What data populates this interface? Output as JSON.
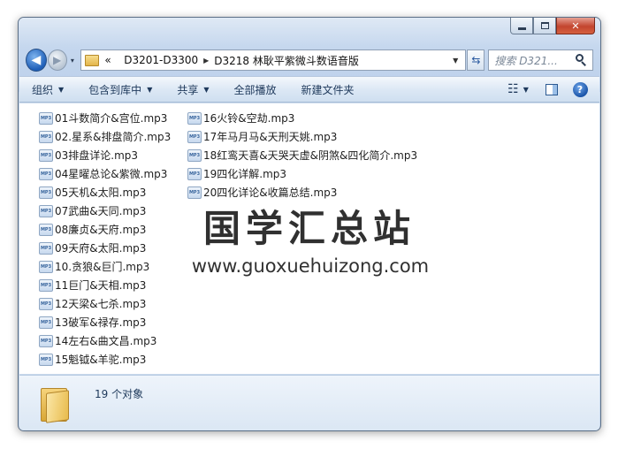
{
  "window": {
    "nav": {
      "back_glyph": "◀",
      "forward_glyph": "▶",
      "recent_glyph": "▾"
    },
    "address": {
      "overflow": "«",
      "crumbs": [
        "D3201-D3300",
        "D3218 林耿平紫微斗数语音版"
      ]
    },
    "search": {
      "placeholder": "搜索 D321..."
    },
    "toolbar": {
      "organize": "组织",
      "include_in_library": "包含到库中",
      "share": "共享",
      "play_all": "全部播放",
      "new_folder": "新建文件夹"
    },
    "icons": {
      "back": "back-arrow-icon",
      "forward": "forward-arrow-icon",
      "refresh": "refresh-icon",
      "search": "search-icon",
      "views": "view-options-icon",
      "preview_pane": "preview-pane-icon",
      "help": "help-icon",
      "file": "mp3-file-icon",
      "folder": "folder-icon"
    },
    "file_icon_label": "MP3",
    "files_col1": [
      "01斗数简介&宫位.mp3",
      "02.星系&排盘简介.mp3",
      "03排盘详论.mp3",
      "04星曜总论&紫微.mp3",
      "05天机&太阳.mp3",
      "07武曲&天同.mp3",
      "08廉贞&天府.mp3",
      "09天府&太阳.mp3",
      "10.贪狼&巨门.mp3",
      "11巨门&天相.mp3",
      "12天梁&七杀.mp3",
      "13破军&禄存.mp3",
      "14左右&曲文昌.mp3",
      "15魁钺&羊驼.mp3"
    ],
    "files_col2": [
      "16火铃&空劫.mp3",
      "17年马月马&天刑天姚.mp3",
      "18红鸾天喜&天哭天虚&阴煞&四化简介.mp3",
      "19四化详解.mp3",
      "20四化详论&收篇总结.mp3"
    ],
    "watermark": {
      "title": "国学汇总站",
      "url": "www.guoxuehuizong.com"
    },
    "status": {
      "count": "19 个对象"
    },
    "colors": {
      "frame": "#c9d9ec",
      "toolbar_text": "#1e395b",
      "accent": "#1f5fb8"
    }
  }
}
